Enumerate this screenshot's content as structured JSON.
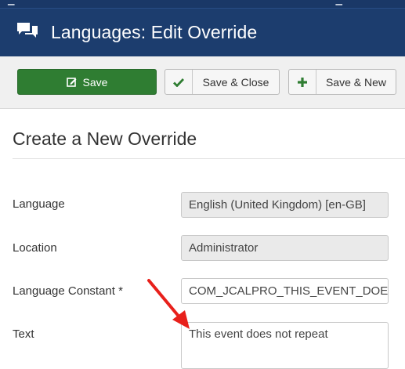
{
  "header": {
    "title": "Languages: Edit Override",
    "icon": "comments-icon",
    "background": "#1c3d6e"
  },
  "toolbar": {
    "save_label": "Save",
    "save_close_label": "Save & Close",
    "save_new_label": "Save & New",
    "save_color": "#2f7d32"
  },
  "form": {
    "section_title": "Create a New Override",
    "language": {
      "label": "Language",
      "value": "English (United Kingdom) [en-GB]"
    },
    "location": {
      "label": "Location",
      "value": "Administrator"
    },
    "constant": {
      "label": "Language Constant *",
      "value": "COM_JCALPRO_THIS_EVENT_DOES_NOT_REPEAT"
    },
    "text": {
      "label": "Text",
      "value": "This event does not repeat"
    }
  },
  "annotation": {
    "arrow_color": "#e8201b"
  }
}
